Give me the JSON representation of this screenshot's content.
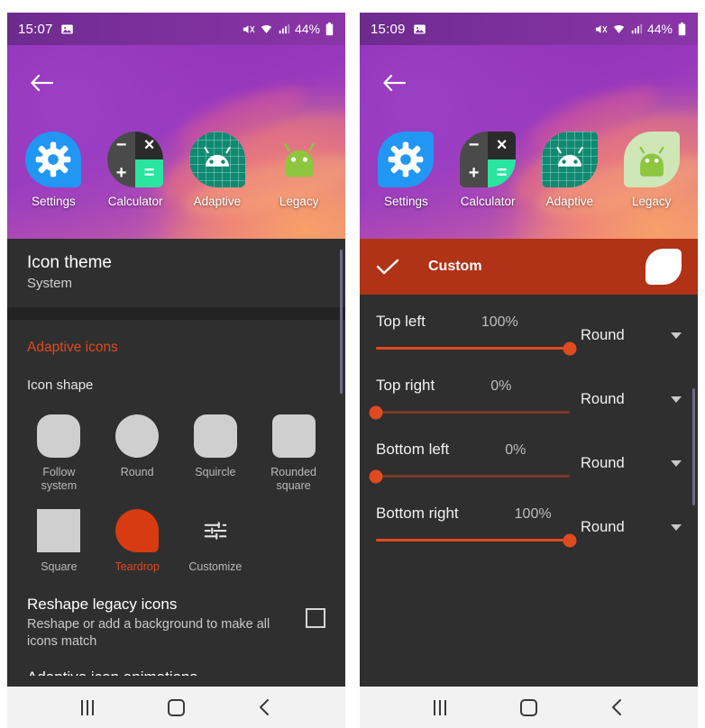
{
  "app": {
    "accent": "#e04a1f",
    "header_bg": "#b03317",
    "panel_bg": "#2f2f2f"
  },
  "left": {
    "status": {
      "time": "15:07",
      "image_icon": "image-icon",
      "mute_icon": "mute-icon",
      "wifi_icon": "wifi-icon",
      "signal_icon": "signal-icon",
      "battery_pct": "44%",
      "battery_icon": "battery-icon"
    },
    "back_icon": "back-arrow-icon",
    "preview_icons": [
      {
        "label": "Settings",
        "art": "settings-gear-icon",
        "shape": "teardrop"
      },
      {
        "label": "Calculator",
        "art": "calculator-icon",
        "shape": "teardrop"
      },
      {
        "label": "Adaptive",
        "art": "adaptive-android-icon",
        "shape": "teardrop"
      },
      {
        "label": "Legacy",
        "art": "legacy-android-icon",
        "shape": "none"
      }
    ],
    "icon_theme": {
      "title": "Icon theme",
      "value": "System"
    },
    "section_adaptive": "Adaptive icons",
    "icon_shape_label": "Icon shape",
    "shapes": [
      {
        "name": "Follow\nsystem",
        "key": "followsystem",
        "selected": false
      },
      {
        "name": "Round",
        "key": "round",
        "selected": false
      },
      {
        "name": "Squircle",
        "key": "squircle",
        "selected": false
      },
      {
        "name": "Rounded\nsquare",
        "key": "roundedsquare",
        "selected": false
      },
      {
        "name": "Square",
        "key": "square",
        "selected": false
      },
      {
        "name": "Teardrop",
        "key": "teardrop",
        "selected": true
      },
      {
        "name": "Customize",
        "key": "customize",
        "selected": false
      }
    ],
    "reshape": {
      "title": "Reshape legacy icons",
      "subtitle": "Reshape or add a background to make all icons match",
      "checked": false
    },
    "cut_row": "Adaptive icon animations"
  },
  "right": {
    "status": {
      "time": "15:09",
      "image_icon": "image-icon",
      "mute_icon": "mute-icon",
      "wifi_icon": "wifi-icon",
      "signal_icon": "signal-icon",
      "battery_pct": "44%",
      "battery_icon": "battery-icon"
    },
    "back_icon": "back-arrow-icon",
    "preview_icons": [
      {
        "label": "Settings",
        "art": "settings-gear-icon",
        "shape": "leaf"
      },
      {
        "label": "Calculator",
        "art": "calculator-icon",
        "shape": "leaf"
      },
      {
        "label": "Adaptive",
        "art": "adaptive-android-icon",
        "shape": "leaf"
      },
      {
        "label": "Legacy",
        "art": "legacy-android-icon",
        "shape": "leaf"
      }
    ],
    "custom_header": {
      "label": "Custom",
      "check_icon": "check-icon",
      "preview_shape": "leaf-shape-preview"
    },
    "corners": [
      {
        "name": "Top left",
        "percent": "100%",
        "value": 100,
        "mode": "Round"
      },
      {
        "name": "Top right",
        "percent": "0%",
        "value": 0,
        "mode": "Round"
      },
      {
        "name": "Bottom left",
        "percent": "0%",
        "value": 0,
        "mode": "Round"
      },
      {
        "name": "Bottom right",
        "percent": "100%",
        "value": 100,
        "mode": "Round"
      }
    ]
  },
  "navbar": {
    "recents_label": "recents-icon",
    "home_label": "home-icon",
    "back_label": "back-icon"
  },
  "calculator_keys": [
    "−",
    "×",
    "+",
    "="
  ]
}
